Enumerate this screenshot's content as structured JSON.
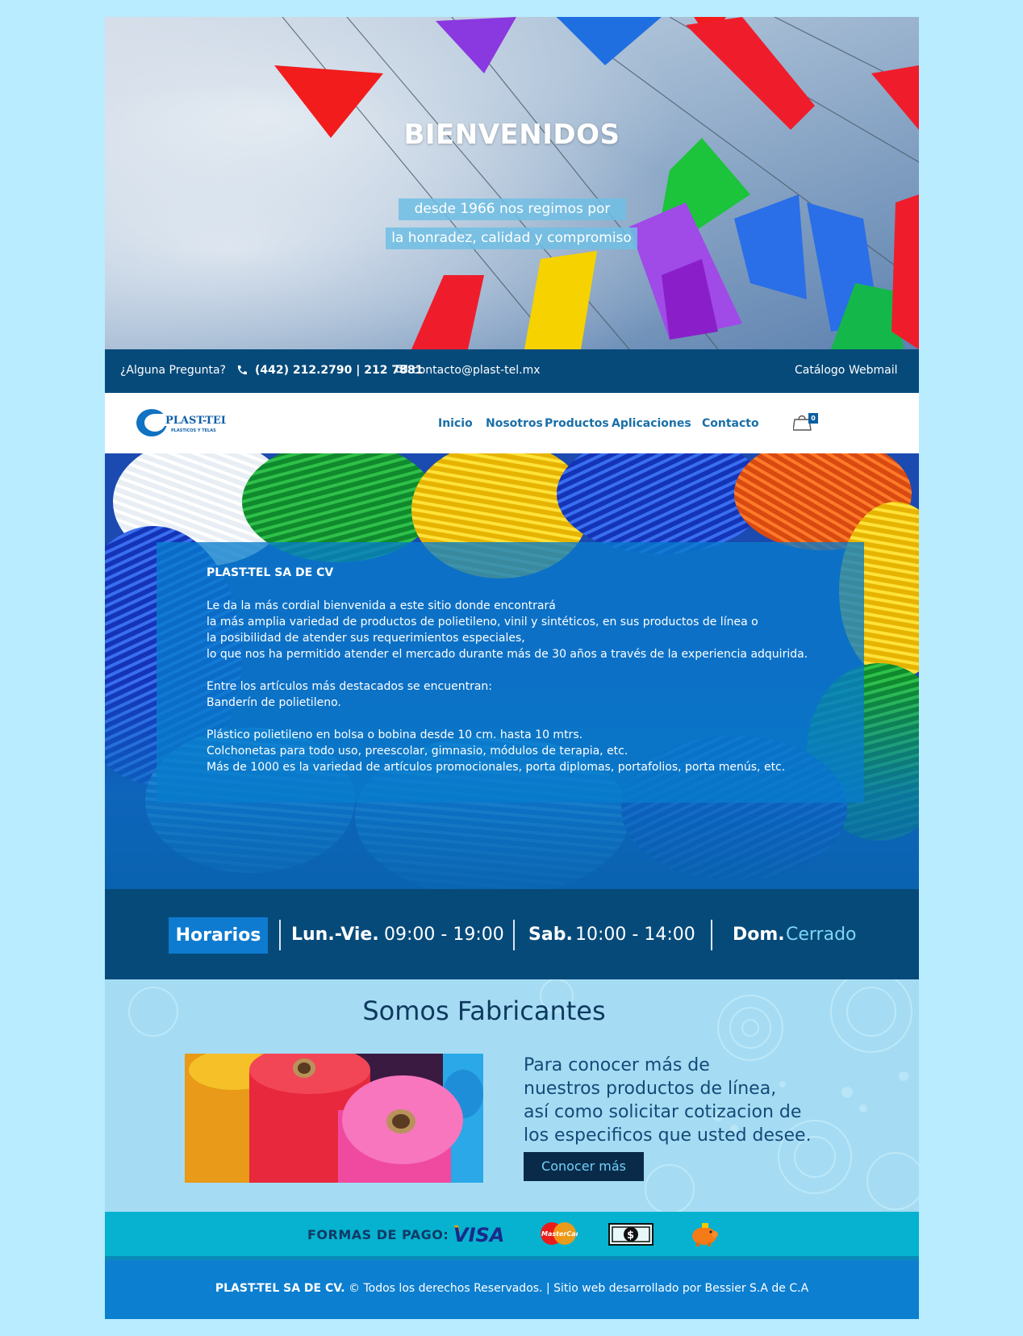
{
  "hero": {
    "title": "BIENVENIDOS",
    "line1": "desde 1966 nos regimos por",
    "line2": "la honradez, calidad y compromiso"
  },
  "topbar": {
    "question": "¿Alguna Pregunta?",
    "phone": "(442) 212.2790 | 212 7881",
    "email": "contacto@plast-tel.mx",
    "links": [
      "Catálogo",
      "Webmail"
    ]
  },
  "nav": {
    "logo_text": "PLAST-TEL",
    "logo_subtext": "PLASTICOS Y TELAS",
    "items": [
      "Inicio",
      "Nosotros",
      "Productos",
      "Aplicaciones",
      "Contacto"
    ],
    "cart_count": "0"
  },
  "intro": {
    "company": "PLAST-TEL SA DE CV",
    "para1": "Le da la más cordial bienvenida a este sitio donde encontrará\nla más amplia variedad de productos de polietileno, vinil y sintéticos, en sus productos de línea o\nla posibilidad de atender sus requerimientos especiales,\nlo que nos ha permitido atender el mercado durante más de 30 años a través de la experiencia adquirida.",
    "para2": "Entre los artículos más destacados se encuentran:\nBanderín de polietileno.",
    "para3": "Plástico polietileno en bolsa o bobina desde 10 cm. hasta 10 mtrs.\nColchonetas para todo uso, preescolar, gimnasio, módulos de terapia, etc.\nMás de 1000 es la variedad de artículos promocionales, porta diplomas, portafolios, porta menús, etc."
  },
  "hours": {
    "tag": "Horarios",
    "weekday_label": "Lun.-Vie.",
    "weekday_time": "09:00 - 19:00",
    "saturday_label": "Sab.",
    "saturday_time": "10:00 - 14:00",
    "sunday_label": "Dom.",
    "sunday_time": "Cerrado"
  },
  "fabricantes": {
    "title": "Somos Fabricantes",
    "text": "Para conocer más de\nnuestros productos de línea,\nasí como solicitar cotizacion de\nlos especificos que usted desee.",
    "button": "Conocer más"
  },
  "payment": {
    "label": "FORMAS DE PAGO:",
    "methods": [
      "visa-icon",
      "mastercard-icon",
      "cash-icon",
      "piggy-bank-icon"
    ],
    "visa_text": "VISA",
    "mastercard_text": "MasterCard"
  },
  "footer": {
    "company": "PLAST-TEL SA DE CV.",
    "rights": " © Todos los derechos Reservados.  |  Sitio web desarrollado por Bessier S.A de C.A"
  },
  "colors": {
    "page_bg": "#b8ecfe",
    "dark_blue": "#064a7a",
    "accent_blue": "#0e7bd0",
    "nav_link": "#1a6fa8",
    "payment_bar": "#06b2cf",
    "footer": "#0c7fd0"
  }
}
